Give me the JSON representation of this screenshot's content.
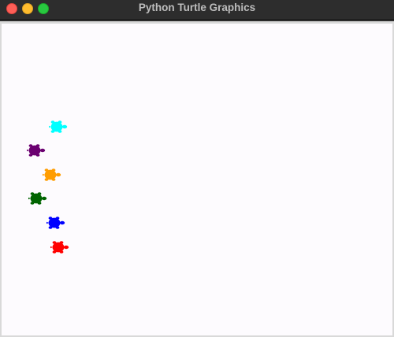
{
  "window": {
    "title": "Python Turtle Graphics",
    "controls": {
      "close_icon": "close-icon",
      "minimize_icon": "minimize-icon",
      "zoom_icon": "zoom-icon",
      "close_color": "#fe5f57",
      "minimize_color": "#febc2e",
      "zoom_color": "#28c840"
    }
  },
  "canvas": {
    "background": "#fdfbfe",
    "turtles": [
      {
        "name": "turtle-cyan",
        "color": "#00ffff",
        "icon": "turtle-icon"
      },
      {
        "name": "turtle-purple",
        "color": "#6b0070",
        "icon": "turtle-icon"
      },
      {
        "name": "turtle-orange",
        "color": "#ff9d00",
        "icon": "turtle-icon"
      },
      {
        "name": "turtle-green",
        "color": "#006400",
        "icon": "turtle-icon"
      },
      {
        "name": "turtle-blue",
        "color": "#0000ff",
        "icon": "turtle-icon"
      },
      {
        "name": "turtle-red",
        "color": "#ff0000",
        "icon": "turtle-icon"
      }
    ]
  }
}
